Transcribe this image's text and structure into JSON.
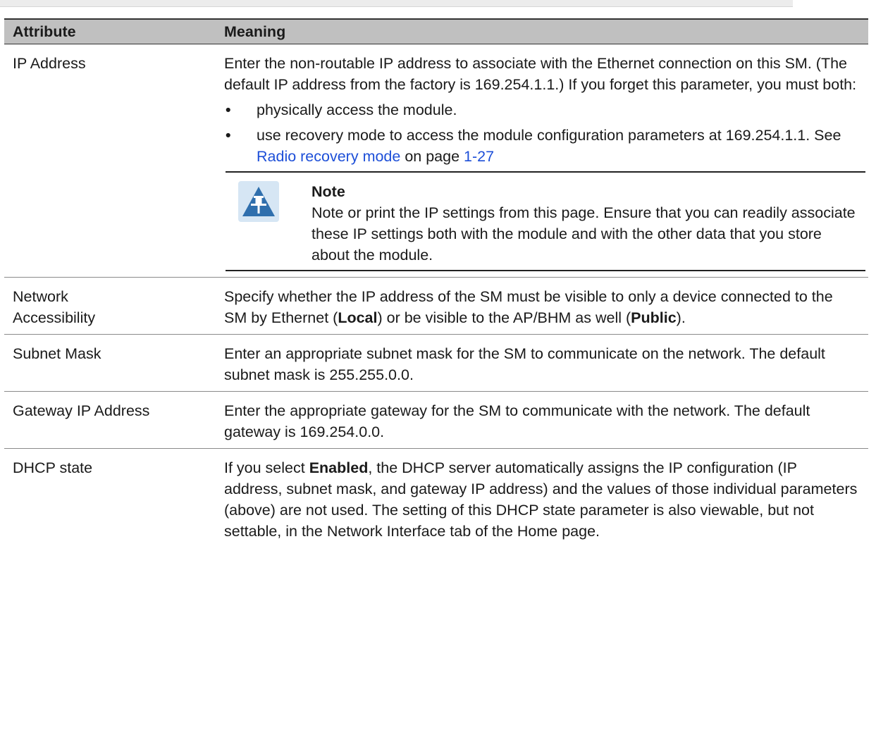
{
  "table": {
    "headers": {
      "attribute": "Attribute",
      "meaning": "Meaning"
    },
    "rows": {
      "ip_address": {
        "attribute": "IP Address",
        "text": "Enter the non-routable IP address to associate with the Ethernet connection on this SM. (The default IP address from the factory is 169.254.1.1.) If you forget this parameter, you must both:",
        "bullet1": "physically access the module.",
        "bullet2_pre": "use recovery mode to access the module configuration parameters at 169.254.1.1. See ",
        "bullet2_link": "Radio recovery mode",
        "bullet2_mid": " on page ",
        "bullet2_page": "1-27",
        "note_title": "Note",
        "note_text": "Note or print the IP settings from this page. Ensure that you can readily associate these IP settings both with the module and with the other data that you store about the module."
      },
      "network_accessibility": {
        "attribute_line1": "Network",
        "attribute_line2": "Accessibility",
        "text_pre": "Specify whether the IP address of the SM must be visible to only a device connected to the SM by Ethernet (",
        "bold1": "Local",
        "text_mid": ") or be visible to the AP/BHM as well (",
        "bold2": "Public",
        "text_post": ")."
      },
      "subnet_mask": {
        "attribute": "Subnet Mask",
        "text": "Enter an appropriate subnet mask for the SM to communicate on the network. The default subnet mask is 255.255.0.0."
      },
      "gateway_ip": {
        "attribute": "Gateway IP Address",
        "text": "Enter the appropriate gateway for the SM to communicate with the network. The default gateway is 169.254.0.0."
      },
      "dhcp_state": {
        "attribute": "DHCP state",
        "text_pre": "If you select ",
        "bold": "Enabled",
        "text_post": ", the DHCP server automatically assigns the IP configuration (IP address, subnet mask, and gateway IP address) and the values of those individual parameters (above) are not used. The setting of this DHCP state parameter is also viewable, but not settable, in the Network Interface tab of the Home page."
      }
    }
  },
  "colors": {
    "header_bg": "#c0c0c0",
    "link": "#1d4fd8",
    "note_icon_bg": "#d6e6f4",
    "note_icon_fg": "#2f6fad"
  },
  "icons": {
    "note": "pushpin-triangle-icon"
  }
}
